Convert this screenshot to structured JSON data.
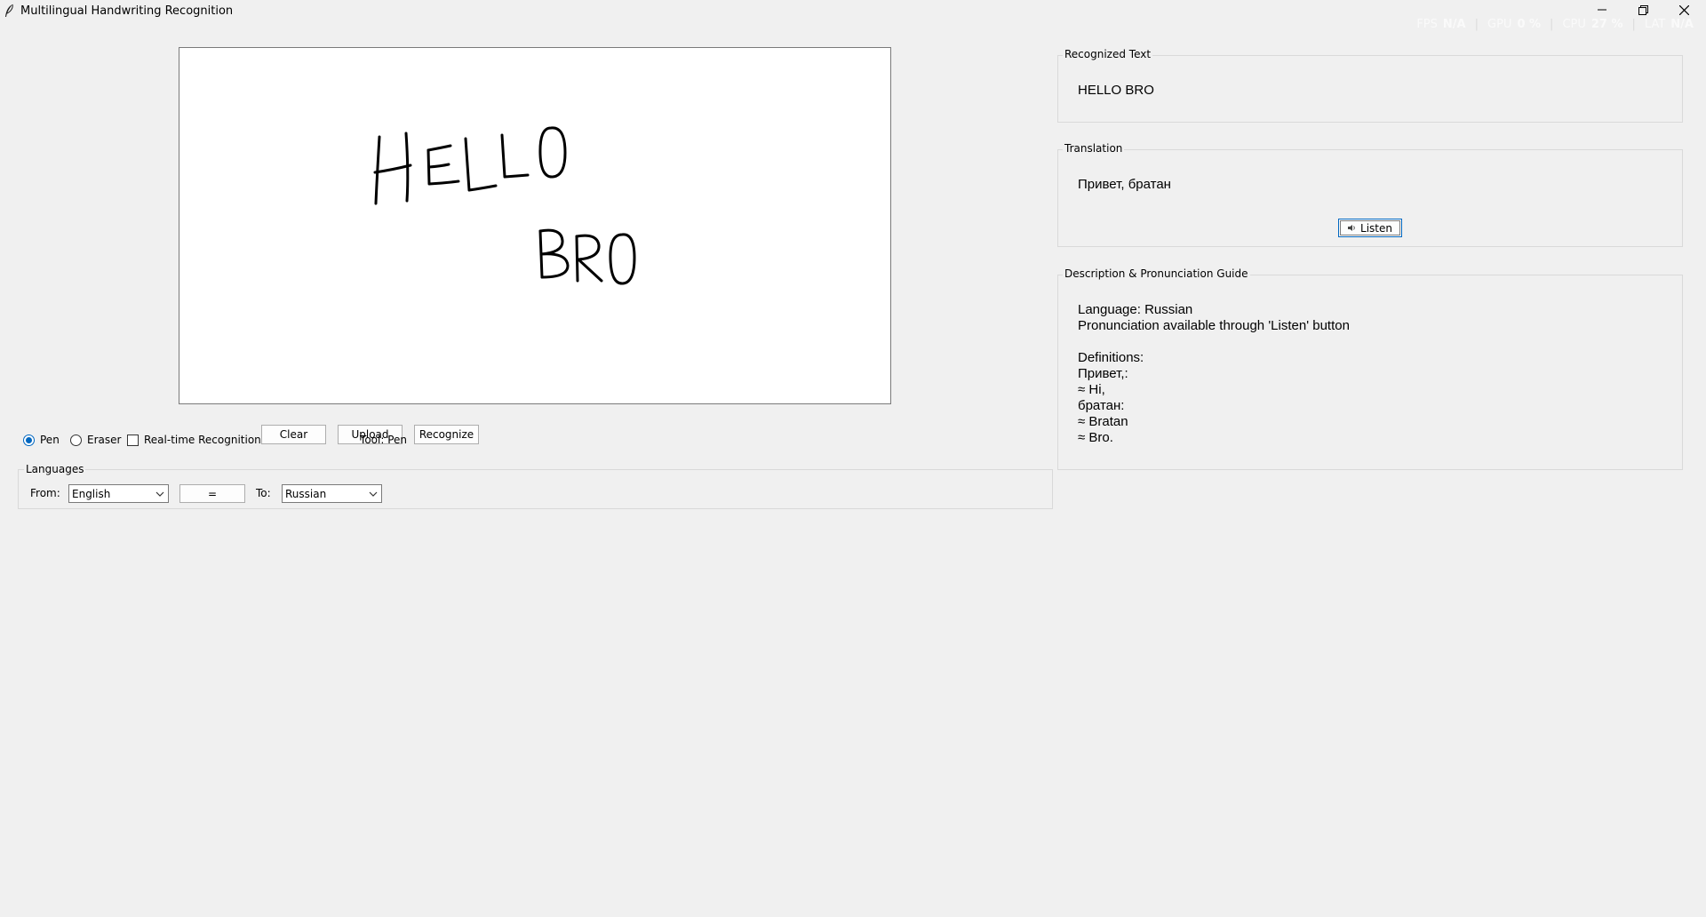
{
  "window": {
    "title": "Multilingual Handwriting Recognition"
  },
  "hud": {
    "fps_label": "FPS",
    "fps_value": "N/A",
    "gpu_label": "GPU",
    "gpu_value": "0 %",
    "cpu_label": "CPU",
    "cpu_value": "27 %",
    "lat_label": "LAT",
    "lat_value": "N/A"
  },
  "toolbar": {
    "pen_label": "Pen",
    "pen_selected": true,
    "eraser_label": "Eraser",
    "eraser_selected": false,
    "realtime_label": "Real-time Recognition",
    "realtime_checked": false,
    "clear_label": "Clear",
    "upload_label": "Upload",
    "recognize_label": "Recognize",
    "tool_status": "Tool: Pen"
  },
  "languages": {
    "group_label": "Languages",
    "from_label": "From:",
    "from_value": "English",
    "swap_label": "=",
    "to_label": "To:",
    "to_value": "Russian"
  },
  "recognized": {
    "label": "Recognized Text",
    "text": "HELLO BRO"
  },
  "translation": {
    "label": "Translation",
    "text": "Привет, братан",
    "listen_label": "Listen"
  },
  "description": {
    "label": "Description & Pronunciation Guide",
    "text": "Language: Russian\nPronunciation available through 'Listen' button\n\nDefinitions:\nПривет,:\n≈ Hi,\nбратан:\n≈ Bratan\n≈ Bro."
  },
  "icons": {
    "app": "feather-icon",
    "minimize": "minimize-icon",
    "restore": "restore-icon",
    "close": "close-icon",
    "speaker": "speaker-icon"
  },
  "colors": {
    "background": "#f0f0f0",
    "accent": "#0067c0",
    "border": "#d9d9d9"
  }
}
